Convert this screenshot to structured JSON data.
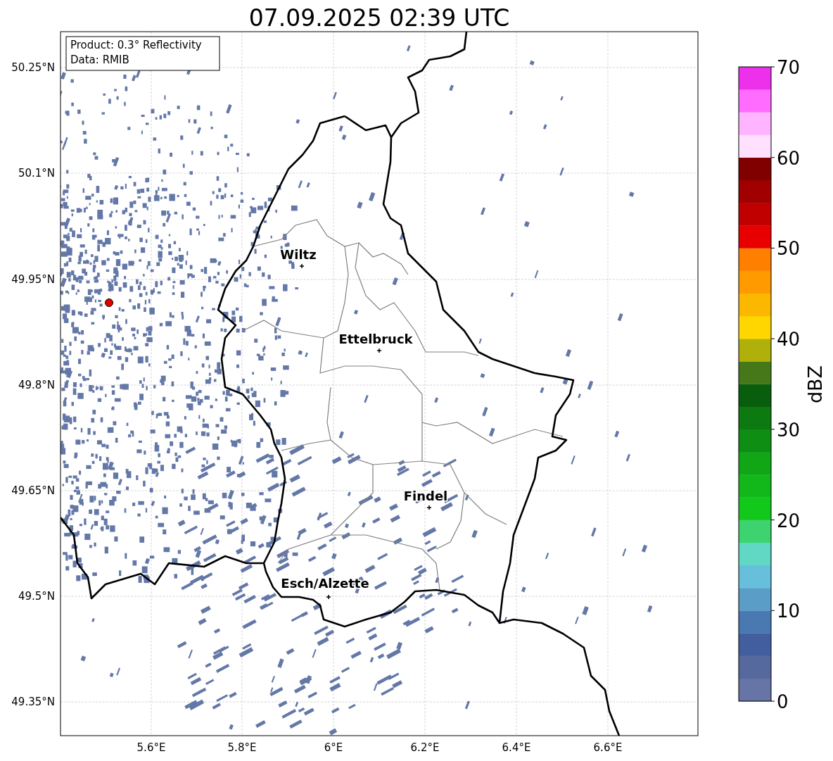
{
  "title": "07.09.2025 02:39 UTC",
  "info_box": [
    "Product: 0.3° Reflectivity",
    "Data: RMIB"
  ],
  "map": {
    "lat_ticks": [
      "50.25°N",
      "50.1°N",
      "49.95°N",
      "49.8°N",
      "49.65°N",
      "49.5°N",
      "49.35°N"
    ],
    "lon_ticks": [
      "5.6°E",
      "5.8°E",
      "6°E",
      "6.2°E",
      "6.4°E",
      "6.6°E"
    ],
    "cities": [
      {
        "name": "Wiltz"
      },
      {
        "name": "Ettelbruck"
      },
      {
        "name": "Findel"
      },
      {
        "name": "Esch/Alzette"
      }
    ]
  },
  "colorbar": {
    "label": "dBZ",
    "ticks": [
      "70",
      "60",
      "50",
      "40",
      "30",
      "20",
      "10",
      "0"
    ],
    "bins": [
      {
        "color": "#6674a6"
      },
      {
        "color": "#56699e"
      },
      {
        "color": "#435e9f"
      },
      {
        "color": "#4a78b0"
      },
      {
        "color": "#5a9ec8"
      },
      {
        "color": "#66bfdb"
      },
      {
        "color": "#60d8c4"
      },
      {
        "color": "#3dd470"
      },
      {
        "color": "#12c81a"
      },
      {
        "color": "#12b81a"
      },
      {
        "color": "#10a616"
      },
      {
        "color": "#0e8f14"
      },
      {
        "color": "#0c7a10"
      },
      {
        "color": "#085e0c"
      },
      {
        "color": "#46781a"
      },
      {
        "color": "#b0b00a"
      },
      {
        "color": "#ffd600"
      },
      {
        "color": "#fcb800"
      },
      {
        "color": "#ff9a00"
      },
      {
        "color": "#ff8000"
      },
      {
        "color": "#e80000"
      },
      {
        "color": "#c00000"
      },
      {
        "color": "#a00000"
      },
      {
        "color": "#800000"
      },
      {
        "color": "#ffe0ff"
      },
      {
        "color": "#ffb4ff"
      },
      {
        "color": "#ff6cff"
      },
      {
        "color": "#ec30ec"
      }
    ]
  }
}
